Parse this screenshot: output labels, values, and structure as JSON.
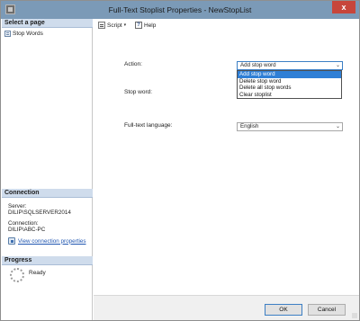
{
  "window": {
    "title": "Full-Text Stoplist Properties - NewStopList",
    "close_glyph": "x"
  },
  "left_pane": {
    "select_page_header": "Select a page",
    "pages": [
      {
        "label": "Stop Words",
        "icon": "page-icon"
      }
    ],
    "connection_header": "Connection",
    "server_label": "Server:",
    "server_value": "DILIP\\SQLSERVER2014",
    "connection_label": "Connection:",
    "connection_value": "DILIP\\ABC-PC",
    "view_connection_properties": "View connection properties",
    "progress_header": "Progress",
    "progress_status": "Ready"
  },
  "toolbar": {
    "script_label": "Script",
    "help_label": "Help",
    "dropdown_glyph": "▾",
    "help_glyph": "?"
  },
  "form": {
    "action_label": "Action:",
    "action_value": "Add stop word",
    "action_options": [
      "Add stop word",
      "Delete stop word",
      "Delete all stop words",
      "Clear stoplist"
    ],
    "stop_word_label": "Stop word:",
    "language_label": "Full-text language:",
    "language_value": "English",
    "chevron_glyph": "⌄"
  },
  "footer": {
    "ok_label": "OK",
    "cancel_label": "Cancel"
  },
  "colors": {
    "titlebar": "#7b9ab7",
    "close_button": "#c7463b",
    "selected_option": "#2f7fd6",
    "section_header": "#cfdcec"
  }
}
